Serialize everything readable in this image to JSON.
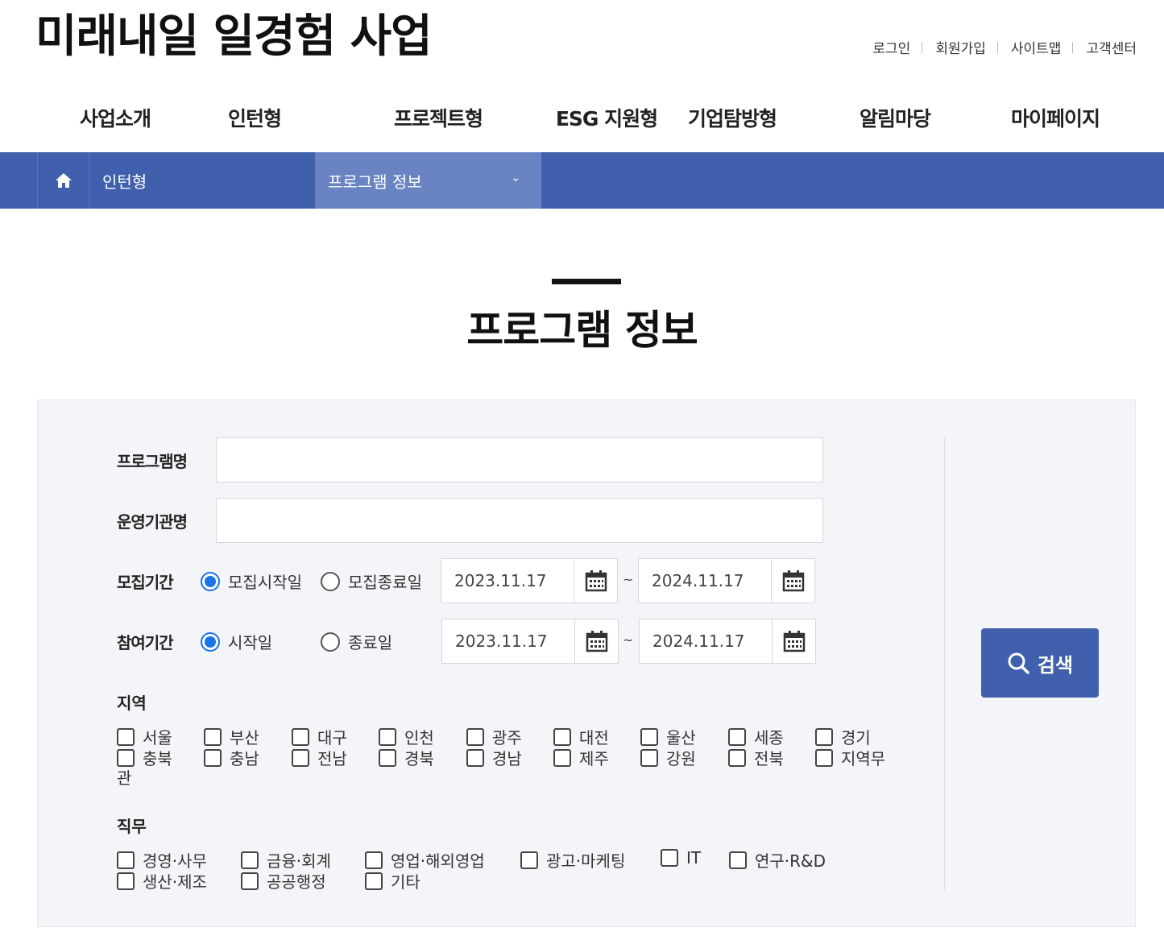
{
  "site": {
    "title": "미래내일 일경험 사업"
  },
  "util_links": [
    "로그인",
    "회원가입",
    "사이트맵",
    "고객센터"
  ],
  "gnb": [
    "사업소개",
    "인턴형",
    "프로젝트형",
    "ESG 지원형",
    "기업탐방형",
    "알림마당",
    "마이페이지"
  ],
  "breadcrumb": {
    "home_icon": "home-icon",
    "level1": "인턴형",
    "level2": "프로그램 정보"
  },
  "page": {
    "title": "프로그램 정보"
  },
  "form": {
    "program_name_label": "프로그램명",
    "program_name_value": "",
    "org_name_label": "운영기관명",
    "org_name_value": "",
    "recruit": {
      "label": "모집기간",
      "options": [
        "모집시작일",
        "모집종료일"
      ],
      "selected": "모집시작일",
      "from": "2023.11.17",
      "tilde": "~",
      "to": "2024.11.17"
    },
    "participate": {
      "label": "참여기간",
      "options": [
        "시작일",
        "종료일"
      ],
      "selected": "시작일",
      "from": "2023.11.17",
      "tilde": "~",
      "to": "2024.11.17"
    },
    "region": {
      "label": "지역",
      "row1": [
        "서울",
        "부산",
        "대구",
        "인천",
        "광주",
        "대전",
        "울산",
        "세종",
        "경기"
      ],
      "row2": [
        "충북",
        "충남",
        "전남",
        "경북",
        "경남",
        "제주",
        "강원",
        "전북",
        "지역무"
      ],
      "wrap": "관"
    },
    "job": {
      "label": "직무",
      "row1": [
        "경영·사무",
        "금융·회계",
        "영업·해외영업",
        "광고·마케팅",
        "IT",
        "연구·R&D"
      ],
      "row2": [
        "생산·제조",
        "공공행정",
        "기타"
      ]
    },
    "search_button": "검색"
  },
  "colors": {
    "brand": "#4060ad",
    "brand_light": "#6a83c2",
    "radio_on": "#1a73e8",
    "panel_bg": "#f3f5f8"
  }
}
